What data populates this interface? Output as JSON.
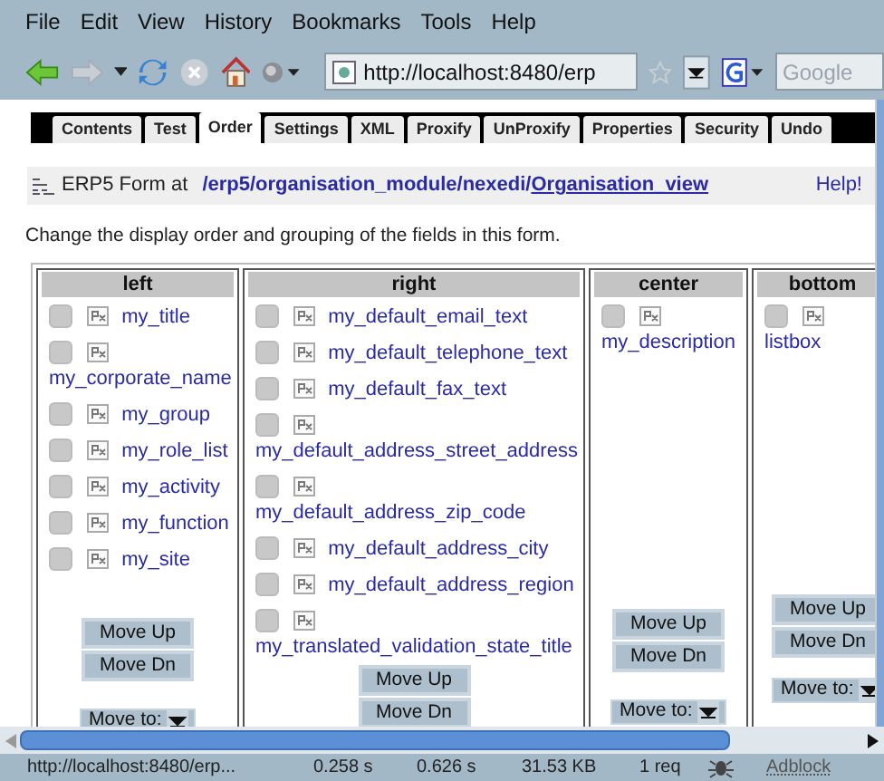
{
  "menu": [
    "File",
    "Edit",
    "View",
    "History",
    "Bookmarks",
    "Tools",
    "Help"
  ],
  "toolbar": {
    "url": "http://localhost:8480/erp",
    "search_placeholder": "Google"
  },
  "tabs": [
    {
      "label": "Contents",
      "selected": false
    },
    {
      "label": "Test",
      "selected": false
    },
    {
      "label": "Order",
      "selected": true
    },
    {
      "label": "Settings",
      "selected": false
    },
    {
      "label": "XML",
      "selected": false
    },
    {
      "label": "Proxify",
      "selected": false
    },
    {
      "label": "UnProxify",
      "selected": false
    },
    {
      "label": "Properties",
      "selected": false
    },
    {
      "label": "Security",
      "selected": false
    },
    {
      "label": "Undo",
      "selected": false
    }
  ],
  "form_header": {
    "prefix": "ERP5 Form at",
    "path": "/erp5/organisation_module/nexedi/",
    "link": "Organisation_view",
    "help": "Help!"
  },
  "description": "Change the display order and grouping of the fields in this form.",
  "groups": [
    {
      "title": "left",
      "fields": [
        {
          "name": "my_title",
          "checked": false
        },
        {
          "name": "my_corporate_name",
          "checked": false
        },
        {
          "name": "my_group",
          "checked": false
        },
        {
          "name": "my_role_list",
          "checked": false
        },
        {
          "name": "my_activity",
          "checked": false
        },
        {
          "name": "my_function",
          "checked": false
        },
        {
          "name": "my_site",
          "checked": false
        }
      ],
      "buttons": [
        "Move Up",
        "Move Dn"
      ],
      "move_to": "Move to:"
    },
    {
      "title": "right",
      "fields": [
        {
          "name": "my_default_email_text",
          "checked": false
        },
        {
          "name": "my_default_telephone_text",
          "checked": false
        },
        {
          "name": "my_default_fax_text",
          "checked": false
        },
        {
          "name": "my_default_address_street_address",
          "checked": false
        },
        {
          "name": "my_default_address_zip_code",
          "checked": false
        },
        {
          "name": "my_default_address_city",
          "checked": false
        },
        {
          "name": "my_default_address_region",
          "checked": false
        },
        {
          "name": "my_translated_validation_state_title",
          "checked": false
        }
      ],
      "buttons": [
        "Move Up",
        "Move Dn"
      ]
    },
    {
      "title": "center",
      "fields": [
        {
          "name": "my_description",
          "checked": false
        }
      ],
      "buttons": [
        "Move Up",
        "Move Dn"
      ],
      "move_to": "Move to:"
    },
    {
      "title": "bottom",
      "fields": [
        {
          "name": "listbox",
          "checked": false
        }
      ],
      "buttons": [
        "Move Up",
        "Move Dn"
      ],
      "move_to": "Move to:"
    }
  ],
  "status_bar": {
    "url": "http://localhost:8480/erp...",
    "time_1": "0.258 s",
    "time_2": "0.626 s",
    "size": "31.53 KB",
    "requests": "1 req",
    "adblock": "Adblock"
  }
}
